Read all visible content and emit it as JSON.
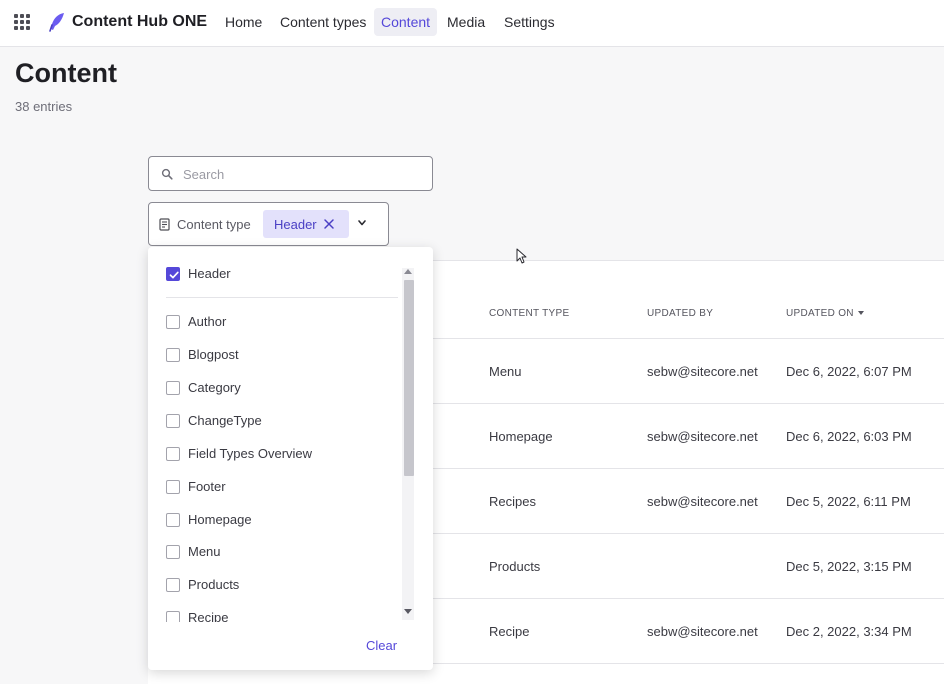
{
  "app": {
    "brand": "Content Hub ONE",
    "nav": [
      {
        "label": "Home",
        "active": false
      },
      {
        "label": "Content types",
        "active": false
      },
      {
        "label": "Content",
        "active": true
      },
      {
        "label": "Media",
        "active": false
      },
      {
        "label": "Settings",
        "active": false
      }
    ]
  },
  "page": {
    "title": "Content",
    "entry_count": "38 entries"
  },
  "search": {
    "placeholder": "Search",
    "value": ""
  },
  "filter": {
    "label": "Content type",
    "selected_chip": "Header"
  },
  "dropdown": {
    "selected": [
      {
        "label": "Header",
        "checked": true
      }
    ],
    "options": [
      {
        "label": "Author",
        "checked": false
      },
      {
        "label": "Blogpost",
        "checked": false
      },
      {
        "label": "Category",
        "checked": false
      },
      {
        "label": "ChangeType",
        "checked": false
      },
      {
        "label": "Field Types Overview",
        "checked": false
      },
      {
        "label": "Footer",
        "checked": false
      },
      {
        "label": "Homepage",
        "checked": false
      },
      {
        "label": "Menu",
        "checked": false
      },
      {
        "label": "Products",
        "checked": false
      },
      {
        "label": "Recipe",
        "checked": false
      }
    ],
    "clear_label": "Clear"
  },
  "table": {
    "columns": {
      "content_type": "CONTENT TYPE",
      "updated_by": "UPDATED BY",
      "updated_on": "UPDATED ON"
    },
    "rows": [
      {
        "content_type": "Menu",
        "updated_by": "sebw@sitecore.net",
        "updated_on": "Dec 6, 2022, 6:07 PM"
      },
      {
        "content_type": "Homepage",
        "updated_by": "sebw@sitecore.net",
        "updated_on": "Dec 6, 2022, 6:03 PM"
      },
      {
        "content_type": "Recipes",
        "updated_by": "sebw@sitecore.net",
        "updated_on": "Dec 5, 2022, 6:11 PM"
      },
      {
        "content_type": "Products",
        "updated_by": "",
        "updated_on": "Dec 5, 2022, 3:15 PM"
      },
      {
        "content_type": "Recipe",
        "updated_by": "sebw@sitecore.net",
        "updated_on": "Dec 2, 2022, 3:34 PM"
      }
    ]
  },
  "colors": {
    "accent": "#5548d9",
    "chip_bg": "#e3e1fb"
  }
}
